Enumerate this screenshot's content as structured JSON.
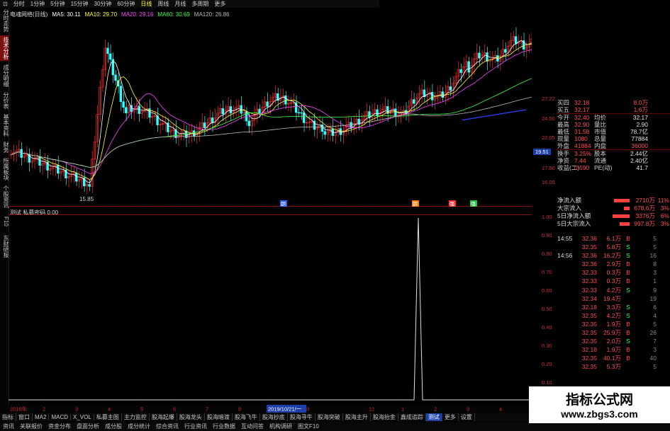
{
  "top_toolbar": {
    "items": [
      "⊡",
      "分时",
      "1分钟",
      "5分钟",
      "15分钟",
      "30分钟",
      "60分钟",
      "日线",
      "周线",
      "月线",
      "多周期",
      "更多"
    ],
    "selected": "日线"
  },
  "left_tabs": [
    "分时走势",
    "技术分析",
    "成分明细",
    "分价表",
    "基本资料",
    "财务",
    "所属板块",
    "个股资讯",
    "F10",
    "东财研报"
  ],
  "left_tabs_active": "技术分析",
  "ma_legend": [
    {
      "label": "电魂网络(日线)",
      "color": "#d8d8d8"
    },
    {
      "label": "MA5: 30.11",
      "color": "#ffffff"
    },
    {
      "label": "MA10: 29.70",
      "color": "#ffff40"
    },
    {
      "label": "MA20: 29.16",
      "color": "#ff40ff"
    },
    {
      "label": "MA60: 30.69",
      "color": "#40ff40"
    },
    {
      "label": "MA120: 26.86",
      "color": "#bbbbbb"
    }
  ],
  "low_label": "15.85",
  "right_axis_main": [
    "27.22",
    "24.50",
    "22.05",
    "19.51",
    "17.86",
    "16.05"
  ],
  "right_axis_current": "19.51",
  "right_axis_ind": [
    "1.00",
    "0.90",
    "0.80",
    "0.70",
    "0.60",
    "0.50",
    "0.40",
    "0.30",
    "0.20",
    "0.10"
  ],
  "indicator_header": "测试  私募密码  0.00",
  "markers": [
    "朗",
    "朗",
    "强",
    "强"
  ],
  "time_axis": [
    "2018年",
    "2",
    "3",
    "4",
    "5",
    "6",
    "7",
    "8",
    "9",
    "10",
    "2019/10/21/一",
    "12",
    "1",
    "2",
    "3",
    "4"
  ],
  "quote": {
    "rows": [
      {
        "l": "买四",
        "v": "32.18",
        "l2": "",
        "v2": "8.0万"
      },
      {
        "l": "买五",
        "v": "32.17",
        "l2": "",
        "v2": "1.6万"
      },
      {
        "l": "今开",
        "v": "32.40",
        "l2": "均价",
        "v2": "32.17"
      },
      {
        "l": "最高",
        "v": "32.90",
        "l2": "量比",
        "v2": "2.90"
      },
      {
        "l": "最低",
        "v": "31.58",
        "l2": "市值",
        "v2": "78.7亿"
      },
      {
        "l": "现量",
        "v": "1080",
        "l2": "总量",
        "v2": "77884"
      },
      {
        "l": "外盘",
        "v": "41884",
        "l2": "内盘",
        "v2": "36000"
      },
      {
        "l": "换手",
        "v": "3.25%",
        "l2": "股本",
        "v2": "2.44亿"
      },
      {
        "l": "净资",
        "v": "7.44",
        "l2": "流通",
        "v2": "2.40亿"
      },
      {
        "l": "收益(二)",
        "v": "0.590",
        "l2": "PE(动)",
        "v2": "41.7"
      }
    ]
  },
  "flows": [
    {
      "label": "净流入额",
      "value": "2710万",
      "pct": "11%",
      "bar": 0.55
    },
    {
      "label": "大宗流入",
      "value": "678.6万",
      "pct": "3%",
      "bar": 0.2
    },
    {
      "label": "5日净流入额",
      "value": "3376万",
      "pct": "6%",
      "bar": 0.6
    },
    {
      "label": "5日大宗流入",
      "value": "997.8万",
      "pct": "3%",
      "bar": 0.35
    }
  ],
  "trades": [
    {
      "t": "14:55",
      "p": "32.36",
      "v": "6.1万",
      "d": "B",
      "x": "5"
    },
    {
      "t": "",
      "p": "32.35",
      "v": "5.8万",
      "d": "S",
      "x": "5"
    },
    {
      "t": "14:56",
      "p": "32.36",
      "v": "16.2万",
      "d": "S",
      "x": "16"
    },
    {
      "t": "",
      "p": "32.36",
      "v": "2.9万",
      "d": "B",
      "x": "8"
    },
    {
      "t": "",
      "p": "32.33",
      "v": "0.3万",
      "d": "B",
      "x": "3"
    },
    {
      "t": "",
      "p": "32.33",
      "v": "0.3万",
      "d": "B",
      "x": "1"
    },
    {
      "t": "",
      "p": "32.33",
      "v": "4.2万",
      "d": "S",
      "x": "9"
    },
    {
      "t": "",
      "p": "32.34",
      "v": "19.4万",
      "d": "",
      "x": "19"
    },
    {
      "t": "",
      "p": "32.18",
      "v": "3.3万",
      "d": "S",
      "x": "6"
    },
    {
      "t": "",
      "p": "32.35",
      "v": "4.2万",
      "d": "S",
      "x": "4"
    },
    {
      "t": "",
      "p": "32.35",
      "v": "1.9万",
      "d": "B",
      "x": "5"
    },
    {
      "t": "",
      "p": "32.35",
      "v": "25.9万",
      "d": "B",
      "x": "26"
    },
    {
      "t": "",
      "p": "32.35",
      "v": "2.0万",
      "d": "S",
      "x": "7"
    },
    {
      "t": "",
      "p": "32.18",
      "v": "1.9万",
      "d": "B",
      "x": "3"
    },
    {
      "t": "",
      "p": "32.35",
      "v": "40.1万",
      "d": "B",
      "x": "40"
    },
    {
      "t": "",
      "p": "32.35",
      "v": "5.3万",
      "d": "",
      "x": "5"
    }
  ],
  "bottom_tabs1": {
    "items": [
      "指标",
      "窗口",
      "MA2",
      "MACD",
      "X_VOL",
      "私募主图",
      "主力监控",
      "股海起爆",
      "股海龙头",
      "股海暗渡",
      "股海飞牛",
      "股海抄底",
      "股海寻牛",
      "股海突破",
      "股海主升",
      "股海抬金",
      "鑫成追踪",
      "测试",
      "更多",
      "设置"
    ],
    "active": "测试"
  },
  "bottom_tabs2": {
    "items": [
      "资讯",
      "关联报价",
      "资金分布",
      "盘面分析",
      "成分股",
      "成分统计",
      "综合资讯",
      "行业资讯",
      "行业数据",
      "互动问答",
      "机构调研",
      "图文F10"
    ]
  },
  "watermark": {
    "title": "指标公式网",
    "url": "www.zbgs3.com"
  },
  "colors": {
    "up": "#ff3030",
    "down": "#30ffff",
    "grid": "#7a0000",
    "axis": "#cc2a2a"
  }
}
